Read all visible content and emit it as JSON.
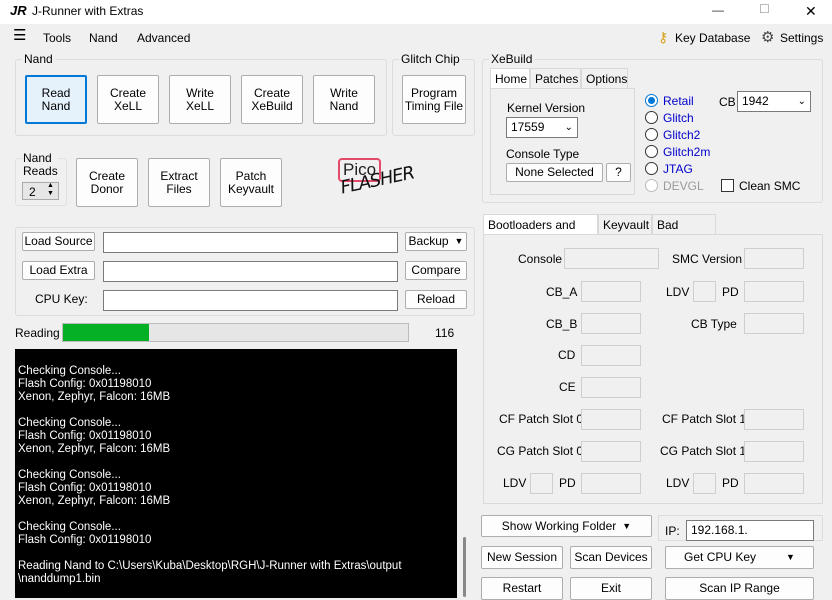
{
  "window": {
    "title": "J-Runner with Extras",
    "controls": [
      "—",
      "☐",
      "✕"
    ]
  },
  "menu": {
    "items": [
      "Tools",
      "Nand",
      "Advanced"
    ],
    "right": [
      "Key Database",
      "Settings"
    ]
  },
  "nand": {
    "title": "Nand",
    "buttons": [
      "Read\nNand",
      "Create\nXeLL",
      "Write\nXeLL",
      "Create\nXeBuild",
      "Write\nNand"
    ]
  },
  "glitch": {
    "title": "Glitch Chip",
    "button": "Program\nTiming File"
  },
  "reads": {
    "title": "Nand\nReads",
    "value": "2"
  },
  "row2": {
    "buttons": [
      "Create\nDonor",
      "Extract\nFiles",
      "Patch\nKeyvault"
    ]
  },
  "logo": {
    "text": "Pico",
    "sub": "FLASHER"
  },
  "xebuild": {
    "title": "XeBuild",
    "tabs": [
      "Home",
      "Patches",
      "Options"
    ],
    "kernel_label": "Kernel Version",
    "kernel_value": "17559",
    "console_label": "Console Type",
    "console_value": "None Selected",
    "help": "?",
    "cb_label": "CB",
    "cb_value": "1942",
    "radios": [
      "Retail",
      "Glitch",
      "Glitch2",
      "Glitch2m",
      "JTAG",
      "DEVGL"
    ],
    "clean_smc": "Clean SMC"
  },
  "files": {
    "load_source": "Load Source",
    "load_extra": "Load Extra",
    "cpu_key": "CPU Key:",
    "backup": "Backup",
    "compare": "Compare",
    "reload": "Reload"
  },
  "progress": {
    "label": "Reading",
    "value": 116,
    "fraction": 0.25
  },
  "log": "Checking Console...\nFlash Config: 0x01198010\nXenon, Zephyr, Falcon: 16MB\n\nChecking Console...\nFlash Config: 0x01198010\nXenon, Zephyr, Falcon: 16MB\n\nChecking Console...\nFlash Config: 0x01198010\nXenon, Zephyr, Falcon: 16MB\n\nChecking Console...\nFlash Config: 0x01198010\n\nReading Nand to C:\\Users\\Kuba\\Desktop\\RGH\\J-Runner with Extras\\output\n\\nanddump1.bin",
  "info": {
    "tabs": [
      "Bootloaders and SMC",
      "Keyvault",
      "Bad Blocks"
    ],
    "labels": {
      "console": "Console",
      "smc": "SMC Version",
      "cba": "CB_A",
      "ldv": "LDV",
      "pd": "PD",
      "cbb": "CB_B",
      "cbtype": "CB Type",
      "cd": "CD",
      "ce": "CE",
      "cf0": "CF Patch Slot 0",
      "cf1": "CF Patch Slot 1",
      "cg0": "CG Patch Slot 0",
      "cg1": "CG Patch Slot 1"
    }
  },
  "bottom": {
    "show_folder": "Show Working Folder",
    "ip_label": "IP:",
    "ip_value": "192.168.1.",
    "new_session": "New Session",
    "scan_devices": "Scan Devices",
    "get_cpu_key": "Get CPU Key",
    "restart": "Restart",
    "exit": "Exit",
    "scan_ip": "Scan IP Range"
  }
}
